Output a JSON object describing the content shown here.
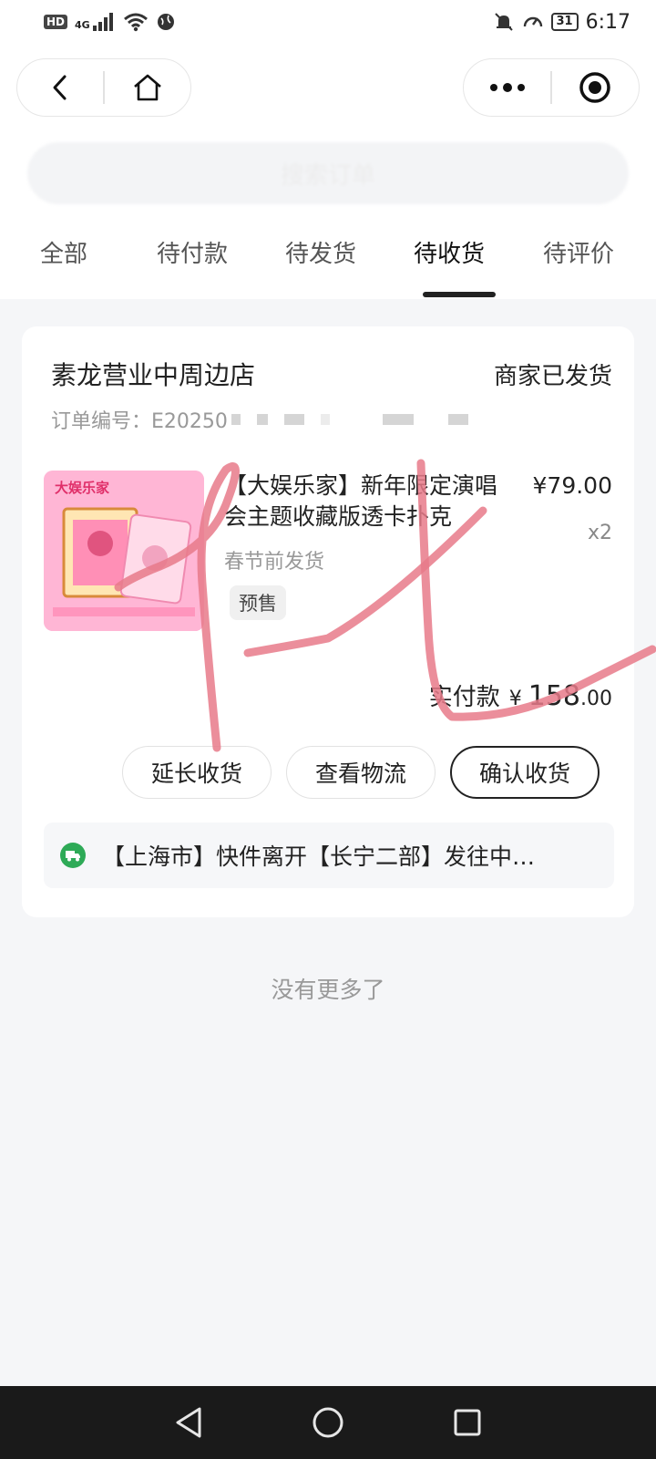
{
  "status_bar": {
    "hd": "HD",
    "network": "4G",
    "battery": "31",
    "time": "6:17"
  },
  "header": {
    "back_icon": "chevron-left-icon",
    "home_icon": "home-icon",
    "more_icon": "more-dots-icon",
    "close_icon": "target-icon",
    "search_placeholder": "搜索订单"
  },
  "tabs": [
    {
      "label": "全部"
    },
    {
      "label": "待付款"
    },
    {
      "label": "待发货"
    },
    {
      "label": "待收货",
      "active": true
    },
    {
      "label": "待评价"
    }
  ],
  "order": {
    "shop_name": "素龙营业中周边店",
    "status": "商家已发货",
    "order_number": "订单编号：E20250",
    "product": {
      "title": "【大娱乐家】新年限定演唱会主题收藏版透卡扑克",
      "price": "¥79.00",
      "quantity": "x2",
      "shipping_note": "春节前发货",
      "tag": "预售",
      "image_text": "大娱乐家"
    },
    "paid_label": "实付款",
    "paid_currency": "¥",
    "paid_integer": "158",
    "paid_decimal": ".00",
    "buttons": {
      "extend": "延长收货",
      "logistics": "查看物流",
      "confirm": "确认收货"
    },
    "logistics_text": "【上海市】快件离开【长宁二部】发往中…"
  },
  "footer": {
    "no_more": "没有更多了"
  },
  "colors": {
    "accent_green": "#2eaa57",
    "scribble": "#e87a8a",
    "background": "#f5f6f8"
  }
}
